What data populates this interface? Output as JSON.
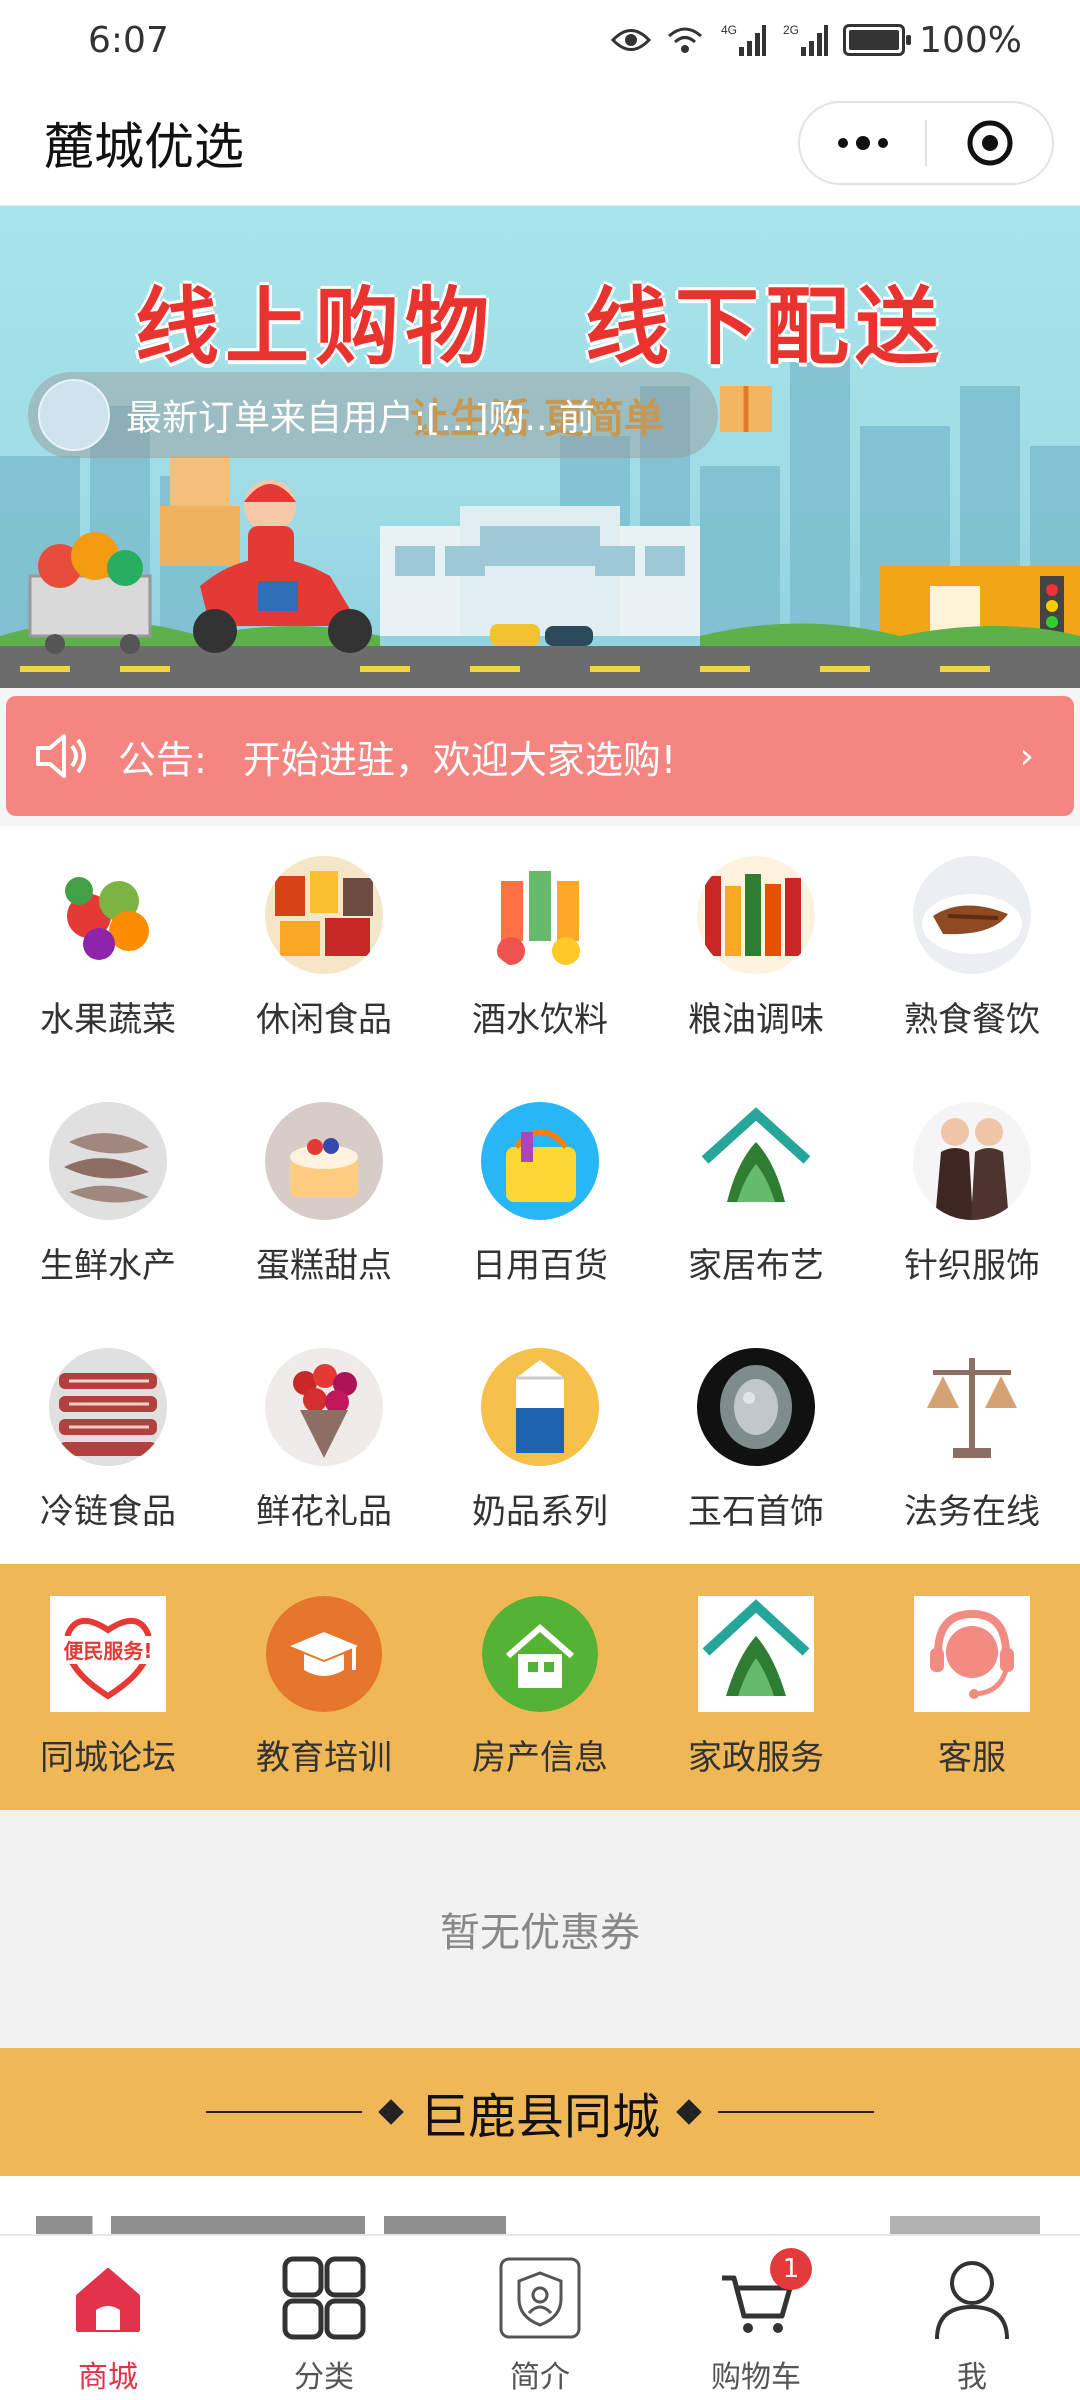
{
  "status_bar": {
    "time": "6:07",
    "battery": "100%",
    "network_1": "4G",
    "network_2": "2G"
  },
  "header": {
    "title": "麓城优选"
  },
  "banner": {
    "headline": "线上购物　线下配送",
    "sub": "让生活 更简单",
    "ticker_text": "最新订单来自用户:[...]购...前"
  },
  "notice": {
    "label": "公告:",
    "text": "开始进驻，欢迎大家选购!"
  },
  "categories": [
    {
      "label": "水果蔬菜",
      "icon": "fruit-veg-icon"
    },
    {
      "label": "休闲食品",
      "icon": "snacks-icon"
    },
    {
      "label": "酒水饮料",
      "icon": "drinks-icon"
    },
    {
      "label": "粮油调味",
      "icon": "grain-oil-icon"
    },
    {
      "label": "熟食餐饮",
      "icon": "cooked-food-icon"
    },
    {
      "label": "生鲜水产",
      "icon": "seafood-icon"
    },
    {
      "label": "蛋糕甜点",
      "icon": "cake-icon"
    },
    {
      "label": "日用百货",
      "icon": "daily-goods-icon"
    },
    {
      "label": "家居布艺",
      "icon": "home-fabric-icon"
    },
    {
      "label": "针织服饰",
      "icon": "clothing-icon"
    },
    {
      "label": "冷链食品",
      "icon": "cold-chain-icon"
    },
    {
      "label": "鲜花礼品",
      "icon": "flowers-icon"
    },
    {
      "label": "奶品系列",
      "icon": "milk-icon"
    },
    {
      "label": "玉石首饰",
      "icon": "jade-icon"
    },
    {
      "label": "法务在线",
      "icon": "legal-icon"
    }
  ],
  "services": [
    {
      "label": "同城论坛",
      "icon": "forum-icon",
      "logo_text": "便民服务!"
    },
    {
      "label": "教育培训",
      "icon": "education-icon"
    },
    {
      "label": "房产信息",
      "icon": "real-estate-icon"
    },
    {
      "label": "家政服务",
      "icon": "housekeeping-icon"
    },
    {
      "label": "客服",
      "icon": "customer-service-icon"
    }
  ],
  "coupon": {
    "empty_text": "暂无优惠券"
  },
  "section": {
    "title": "巨鹿县同城"
  },
  "tabbar": [
    {
      "label": "商城",
      "icon": "home-icon",
      "active": true
    },
    {
      "label": "分类",
      "icon": "grid-icon",
      "active": false
    },
    {
      "label": "简介",
      "icon": "profile-card-icon",
      "active": false
    },
    {
      "label": "购物车",
      "icon": "cart-icon",
      "active": false,
      "badge": "1"
    },
    {
      "label": "我",
      "icon": "user-icon",
      "active": false
    }
  ],
  "colors": {
    "accent": "#e2334b",
    "notice_bg": "#f48580",
    "service_bg": "#f0b757"
  }
}
